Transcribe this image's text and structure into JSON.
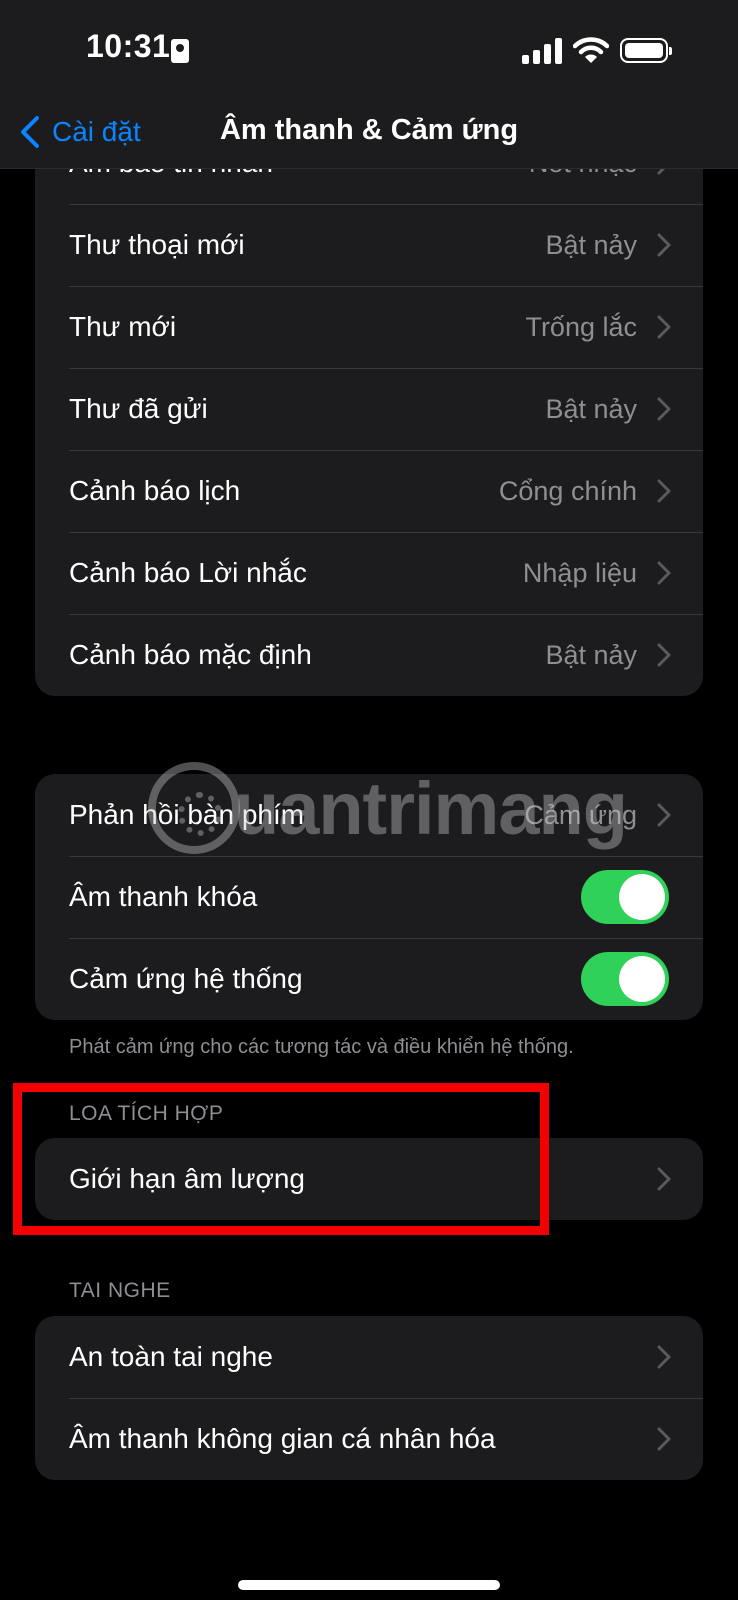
{
  "status_bar": {
    "time": "10:31"
  },
  "nav": {
    "back_label": "Cài đặt",
    "title": "Âm thanh & Cảm ứng"
  },
  "alerts_group": [
    {
      "label": "Âm báo tin nhắn",
      "value": "Nốt nhạc"
    },
    {
      "label": "Thư thoại mới",
      "value": "Bật nảy"
    },
    {
      "label": "Thư mới",
      "value": "Trống lắc"
    },
    {
      "label": "Thư đã gửi",
      "value": "Bật nảy"
    },
    {
      "label": "Cảnh báo lịch",
      "value": "Cổng chính"
    },
    {
      "label": "Cảnh báo Lời nhắc",
      "value": "Nhập liệu"
    },
    {
      "label": "Cảnh báo mặc định",
      "value": "Bật nảy"
    }
  ],
  "feedback_group": {
    "keyboard": {
      "label": "Phản hồi bàn phím",
      "value": "Cảm ứng"
    },
    "lock_sound": {
      "label": "Âm thanh khóa",
      "on": true
    },
    "system_haptics": {
      "label": "Cảm ứng hệ thống",
      "on": true
    },
    "footnote": "Phát cảm ứng cho các tương tác và điều khiển hệ thống."
  },
  "builtin_speaker": {
    "header": "LOA TÍCH HỢP",
    "volume_limit": "Giới hạn âm lượng"
  },
  "headphones": {
    "header": "TAI NGHE",
    "safety": "An toàn tai nghe",
    "spatial": "Âm thanh không gian cá nhân hóa"
  },
  "watermark": "uantrimang",
  "colors": {
    "accent": "#0a84ff",
    "toggle_on": "#30d158",
    "highlight": "#f30000"
  }
}
